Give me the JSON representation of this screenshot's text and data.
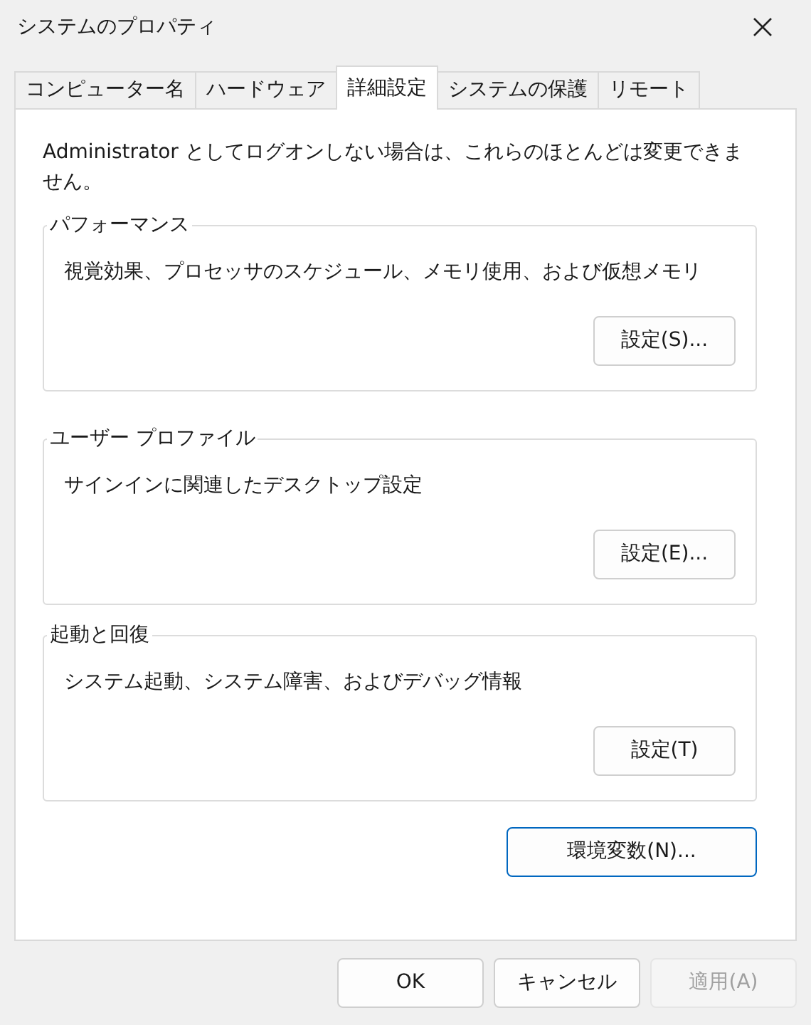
{
  "window": {
    "title": "システムのプロパティ"
  },
  "tabs": [
    {
      "label": "コンピューター名",
      "selected": false
    },
    {
      "label": "ハードウェア",
      "selected": false
    },
    {
      "label": "詳細設定",
      "selected": true
    },
    {
      "label": "システムの保護",
      "selected": false
    },
    {
      "label": "リモート",
      "selected": false
    }
  ],
  "notice": "Administrator としてログオンしない場合は、これらのほとんどは変更できません。",
  "groups": [
    {
      "title": "パフォーマンス",
      "description": "視覚効果、プロセッサのスケジュール、メモリ使用、および仮想メモリ",
      "button": "設定(S)..."
    },
    {
      "title": "ユーザー プロファイル",
      "description": "サインインに関連したデスクトップ設定",
      "button": "設定(E)..."
    },
    {
      "title": "起動と回復",
      "description": "システム起動、システム障害、およびデバッグ情報",
      "button": "設定(T)"
    }
  ],
  "env_button": {
    "label": "環境変数(N)...",
    "focused": true
  },
  "buttons": [
    {
      "label": "OK",
      "disabled": false
    },
    {
      "label": "キャンセル",
      "disabled": false
    },
    {
      "label": "適用(A)",
      "disabled": true
    }
  ]
}
